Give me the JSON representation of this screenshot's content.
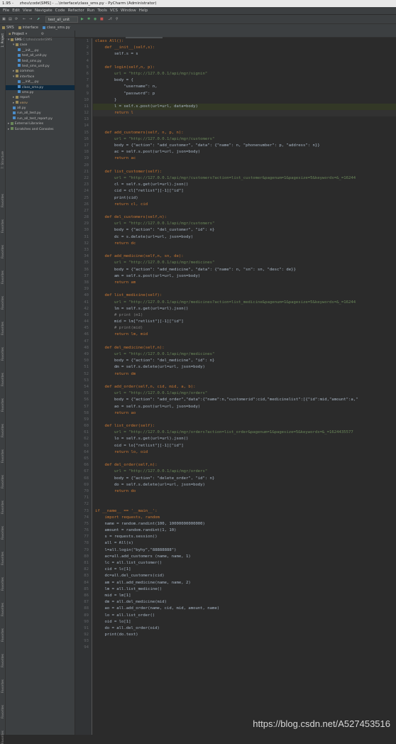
{
  "window": {
    "title": "1.95 -     zhou\\code\\SMS] - ...\\interface\\class_sms.py - PyCharm (Administrator)"
  },
  "menu": [
    "File",
    "Edit",
    "View",
    "Navigate",
    "Code",
    "Refactor",
    "Run",
    "Tools",
    "VCS",
    "Window",
    "Help"
  ],
  "toolbar": {
    "run_config": "test_all_unit"
  },
  "nav": {
    "items": [
      "SMS",
      "interface",
      "class_sms.py"
    ]
  },
  "project": {
    "header": "Project",
    "root_label": "SMS",
    "root_path": "C:\\zhou\\code\\SMS",
    "tree": [
      {
        "label": "case",
        "indent": 1,
        "kind": "dir"
      },
      {
        "label": "__init__.py",
        "indent": 2,
        "kind": "py"
      },
      {
        "label": "test_all_unit.py",
        "indent": 2,
        "kind": "py"
      },
      {
        "label": "test_sms.py",
        "indent": 2,
        "kind": "py"
      },
      {
        "label": "test_sms_unit.py",
        "indent": 2,
        "kind": "py"
      },
      {
        "label": "common",
        "indent": 1,
        "kind": "dir"
      },
      {
        "label": "interface",
        "indent": 1,
        "kind": "dir"
      },
      {
        "label": "__init__.py",
        "indent": 2,
        "kind": "py"
      },
      {
        "label": "class_sms.py",
        "indent": 2,
        "kind": "py",
        "selected": true
      },
      {
        "label": "sms.py",
        "indent": 2,
        "kind": "py"
      },
      {
        "label": "report",
        "indent": 1,
        "kind": "dir"
      },
      {
        "label": "venv",
        "indent": 1,
        "kind": "dir"
      },
      {
        "label": "all.py",
        "indent": 1,
        "kind": "py"
      },
      {
        "label": "run_all_test.py",
        "indent": 1,
        "kind": "py"
      },
      {
        "label": "run_all_test_report.py",
        "indent": 1,
        "kind": "py"
      },
      {
        "label": "External Libraries",
        "indent": 0,
        "kind": "lib"
      },
      {
        "label": "Scratches and Consoles",
        "indent": 0,
        "kind": "lib"
      }
    ]
  },
  "side_labels": {
    "project": "1: Project",
    "structure": "7: Structure",
    "favorites": "Favorites"
  },
  "tabs": [
    {
      "label": "all.py",
      "active": false
    },
    {
      "label": "sms.py",
      "active": false
    },
    {
      "label": "class_sms.py",
      "active": true
    }
  ],
  "code": [
    "class All():",
    "    def __init__(self,s):",
    "        self.s = s",
    "",
    "    def login(self,n, p):",
    "        url = \"http://127.0.0.1/api/mgr/signin\"",
    "        body = {",
    "            \"username\": n,",
    "            \"password\": p",
    "        }",
    "        l = self.s.post(url=url, data=body)",
    "        return l",
    "",
    "",
    "    def add_customers(self, n, p, n):",
    "        url = \"http://127.0.0.1/api/mgr/customers\"",
    "        body = {\"action\": \"add_customer\", \"data\": {\"name\": n, \"phonenumber\": p, \"address\": n}}",
    "        ac = self.s.post(url=url, json=body)",
    "        return ac",
    "",
    "    def list_customer(self):",
    "        url = \"http://127.0.0.1/api/mgr/customers?action=list_customer&pagenum=1&pagesize=5&keywords=&_=16244",
    "        cl = self.s.get(url=url).json()",
    "        cid = cl[\"retlist\"][-1][\"id\"]",
    "        print(cid)",
    "        return cl, cid",
    "",
    "    def del_customers(self,n):",
    "        url = \"http://127.0.0.1/api/mgr/customers\"",
    "        body = {\"action\": \"del_customer\", \"id\": n}",
    "        dc = s.delete(url=url, json=body)",
    "        return dc",
    "",
    "    def add_medicine(self,n, sn, de):",
    "        url = \"http://127.0.0.1/api/mgr/medicines\"",
    "        body = {\"action\": \"add_medicine\", \"data\": {\"name\": n, \"sn\": sn, \"desc\": de}}",
    "        am = self.s.post(url=url, json=body)",
    "        return am",
    "",
    "    def list_medicine(self):",
    "        url = \"http://127.0.0.1/api/mgr/medicines?action=list_medicine&pagenum=1&pagesize=5&keywords=&_=16244",
    "        lm = self.s.get(url=url).json()",
    "        # print (m1)",
    "        mid = lm[\"retlist\"][-1][\"id\"]",
    "        # print(mid)",
    "        return lm, mid",
    "",
    "    def del_medicine(self,n):",
    "        url = \"http://127.0.0.1/api/mgr/medicines\"",
    "        body = {\"action\": \"del_medicine\", \"id\": n}",
    "        dm = self.s.delete(url=url, json=body)",
    "        return dm",
    "",
    "    def add_order(self,n, cid, mid, a, b):",
    "        url = \"http://127.0.0.1/api/mgr/orders\"",
    "        body = {\"action\": \"add_order\",\"data\":{\"name\":n,\"customerid\":cid,\"medicinelist\":[{\"id\":mid,\"amount\":a,\"",
    "        ao = self.s.post(url=url, json=body)",
    "        return ao",
    "",
    "    def list_order(self):",
    "        url = \"http://127.0.0.1/api/mgr/orders?action=list_order&pagenum=1&pagesize=5&keywords=&_=1624435577",
    "        lo = self.s.get(url=url).json()",
    "        oid = lo[\"retlist\"][-1][\"id\"]",
    "        return lo, oid",
    "",
    "    def del_order(self,n):",
    "        url = \"http://127.0.0.1/api/mgr/orders\"",
    "        body = {\"action\": \"delete_order\", \"id\": n}",
    "        do = self.s.delete(url=url, json=body)",
    "        return do",
    "",
    "",
    "if __name__ == '__main__':",
    "    import requests, random",
    "    name = random.randint(100, 10000000000000)",
    "    amount = random.randint(1, 10)",
    "    s = requests.session()",
    "    all = All(s)",
    "    l=all.login(\"byhy\",\"88888888\")",
    "    ac=all.add_customers (name, name, 1)",
    "    lc = all.list_customer()",
    "    cid = lc[1]",
    "    dc=all.del_customers(cid)",
    "    am = all.add_medicine(name, name, 2)",
    "    lm = all.list_medicine()",
    "    mid = lm[1]",
    "    dm = all.del_medicine(mid)",
    "    ao = all.add_order(name, cid, mid, amount, name)",
    "    lo = all.list_order()",
    "    oid = lo[1]",
    "    do = all.del_order(oid)",
    "    print(do.text)",
    "",
    ""
  ],
  "watermark": "https://blog.csdn.net/A527453516"
}
